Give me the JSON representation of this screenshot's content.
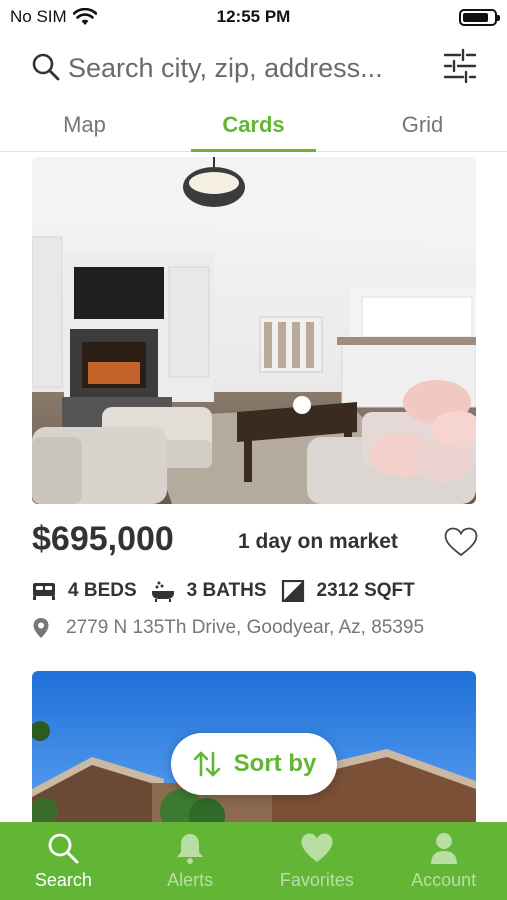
{
  "status_bar": {
    "carrier": "No SIM",
    "time": "12:55 PM",
    "battery_level": 0.85
  },
  "search": {
    "placeholder": "Search city, zip, address..."
  },
  "view_tabs": [
    {
      "label": "Map",
      "active": false
    },
    {
      "label": "Cards",
      "active": true
    },
    {
      "label": "Grid",
      "active": false
    }
  ],
  "listing": {
    "price": "$695,000",
    "market_status": "1 day on market",
    "beds": "4 BEDS",
    "baths": "3 BATHS",
    "sqft": "2312 SQFT",
    "address": "2779 N 135Th Drive, Goodyear, Az, 85395"
  },
  "sort": {
    "label": "Sort by"
  },
  "bottom_nav": [
    {
      "label": "Search",
      "icon": "search-icon",
      "active": true
    },
    {
      "label": "Alerts",
      "icon": "bell-icon",
      "active": false
    },
    {
      "label": "Favorites",
      "icon": "heart-icon",
      "active": false
    },
    {
      "label": "Account",
      "icon": "person-icon",
      "active": false
    }
  ],
  "colors": {
    "accent": "#62b535",
    "text": "#333333",
    "muted": "#777777"
  }
}
